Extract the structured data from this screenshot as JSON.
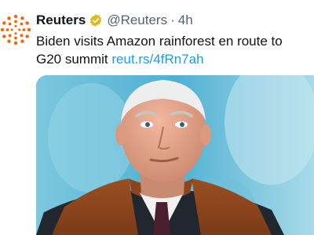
{
  "tweet": {
    "author": {
      "display_name": "Reuters",
      "handle": "@Reuters",
      "verified": true,
      "verified_badge_color": "#e2b719",
      "avatar_icon": "reuters-logo-icon",
      "avatar_color": "#fa6400"
    },
    "separator": "·",
    "timestamp": "4h",
    "text": "Biden visits Amazon rainforest en route to G20 summit",
    "link": "reut.rs/4fRn7ah",
    "link_color": "#1d9bf0"
  }
}
